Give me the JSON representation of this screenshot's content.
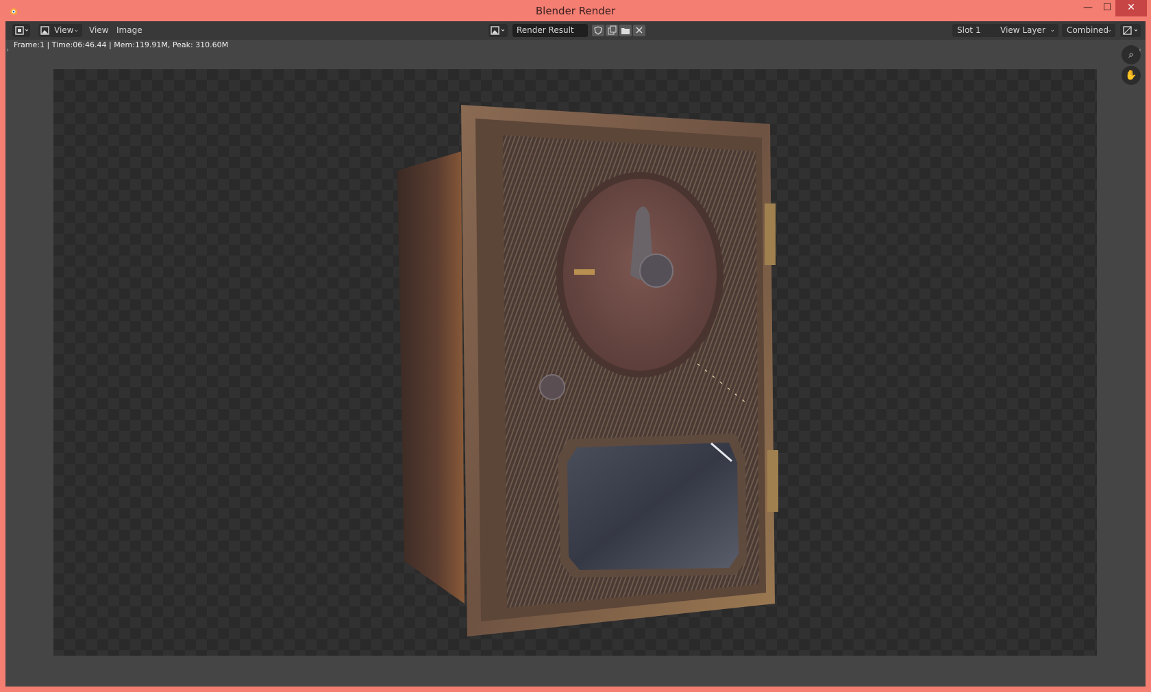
{
  "window": {
    "title": "Blender Render",
    "controls": {
      "minimize": "—",
      "maximize": "☐",
      "close": "✕"
    }
  },
  "header": {
    "view_dropdown": "View",
    "menus": [
      "View",
      "Image"
    ],
    "image_name": "Render Result",
    "slot": "Slot 1",
    "view_layer": "View Layer",
    "pass": "Combined"
  },
  "info": {
    "text": "Frame:1 | Time:06:46.44 | Mem:119.91M, Peak: 310.60M"
  },
  "icons": {
    "app": "blender-logo-icon",
    "zoom": "zoom-icon",
    "pan": "hand-pan-icon",
    "fake_user": "shield-icon",
    "duplicate": "duplicate-icon",
    "open": "folder-icon",
    "unlink": "close-icon"
  },
  "colors": {
    "titlebar": "#f47e72",
    "close_button": "#c74545",
    "editor_bg": "#454545",
    "header_bg": "#393939"
  }
}
